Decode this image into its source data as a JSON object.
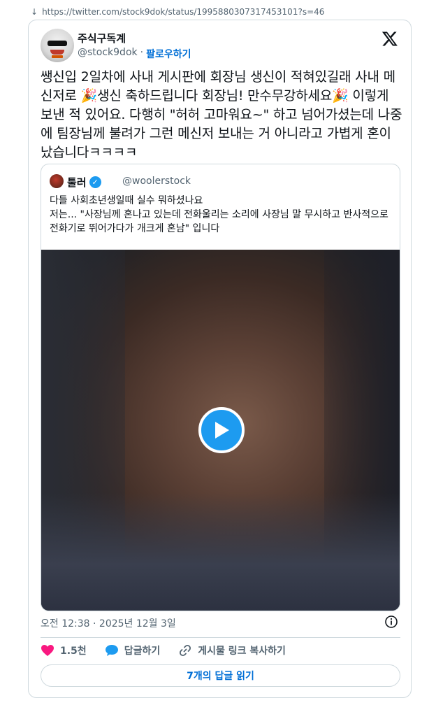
{
  "browser": {
    "url": "https://twitter.com/stock9dok/status/1995880307317453101?s=46"
  },
  "author": {
    "name": "주식구독계",
    "handle": "@stock9dok",
    "separator": "·",
    "follow_label": "팔로우하기"
  },
  "tweet": {
    "text": "쌩신입 2일차에 사내 게시판에 회장님 생신이 적혀있길래 사내 메신저로 🎉생신 축하드립니다 회장님! 만수무강하세요🎉 이렇게 보낸 적 있어요. 다행히 \"허허 고마워요~\" 하고 넘어가셨는데 나중에 팀장님께 불려가 그런 메신저 보내는 거 아니라고 가볍게 혼이 났습니다ㅋㅋㅋㅋ"
  },
  "quoted": {
    "name": "툴러",
    "handle": "@woolerstock",
    "text": "다들 사회초년생일때 실수 뭐하셨나요\n저는... \"사장님께 혼나고 있는데 전화울리는 소리에 사장님 말 무시하고 반사적으로 전화기로 뛰어가다가 개크게 혼남\" 입니다"
  },
  "meta": {
    "timestamp": "오전 12:38 · 2025년 12월 3일"
  },
  "actions": {
    "likes": "1.5천",
    "reply_label": "답글하기",
    "copy_link_label": "게시물 링크 복사하기"
  },
  "footer": {
    "read_replies_label": "7개의 답글 읽기"
  },
  "colors": {
    "accent": "#1d9bf0",
    "link": "#006fd6",
    "like": "#f91880",
    "secondary_text": "#536471",
    "border": "#cfd9de"
  },
  "icons": [
    "download-arrow-icon",
    "x-logo-icon",
    "verified-badge-icon",
    "play-icon",
    "info-icon",
    "heart-icon",
    "reply-bubble-icon",
    "link-icon"
  ]
}
